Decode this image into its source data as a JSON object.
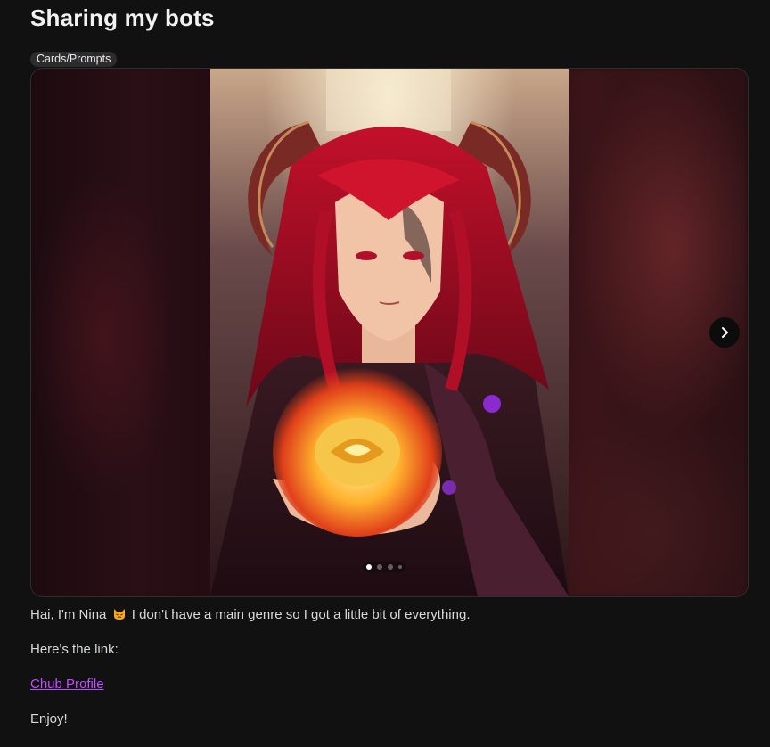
{
  "post": {
    "title": "Sharing my bots",
    "flair": "Cards/Prompts",
    "gallery": {
      "image_count": 4,
      "active_index": 0,
      "next_icon": "chevron-right-icon"
    },
    "body": {
      "intro_before_emoji": "Hai, I'm Nina",
      "emoji": "cat-face-icon",
      "intro_after_emoji": "I don't have a main genre so I got a little bit of everything.",
      "link_intro": "Here's the link:",
      "link_text": "Chub Profile",
      "closing": "Enjoy!"
    }
  },
  "colors": {
    "background": "#111111",
    "link": "#c04dff",
    "flair_bg": "#2c2c2e"
  }
}
